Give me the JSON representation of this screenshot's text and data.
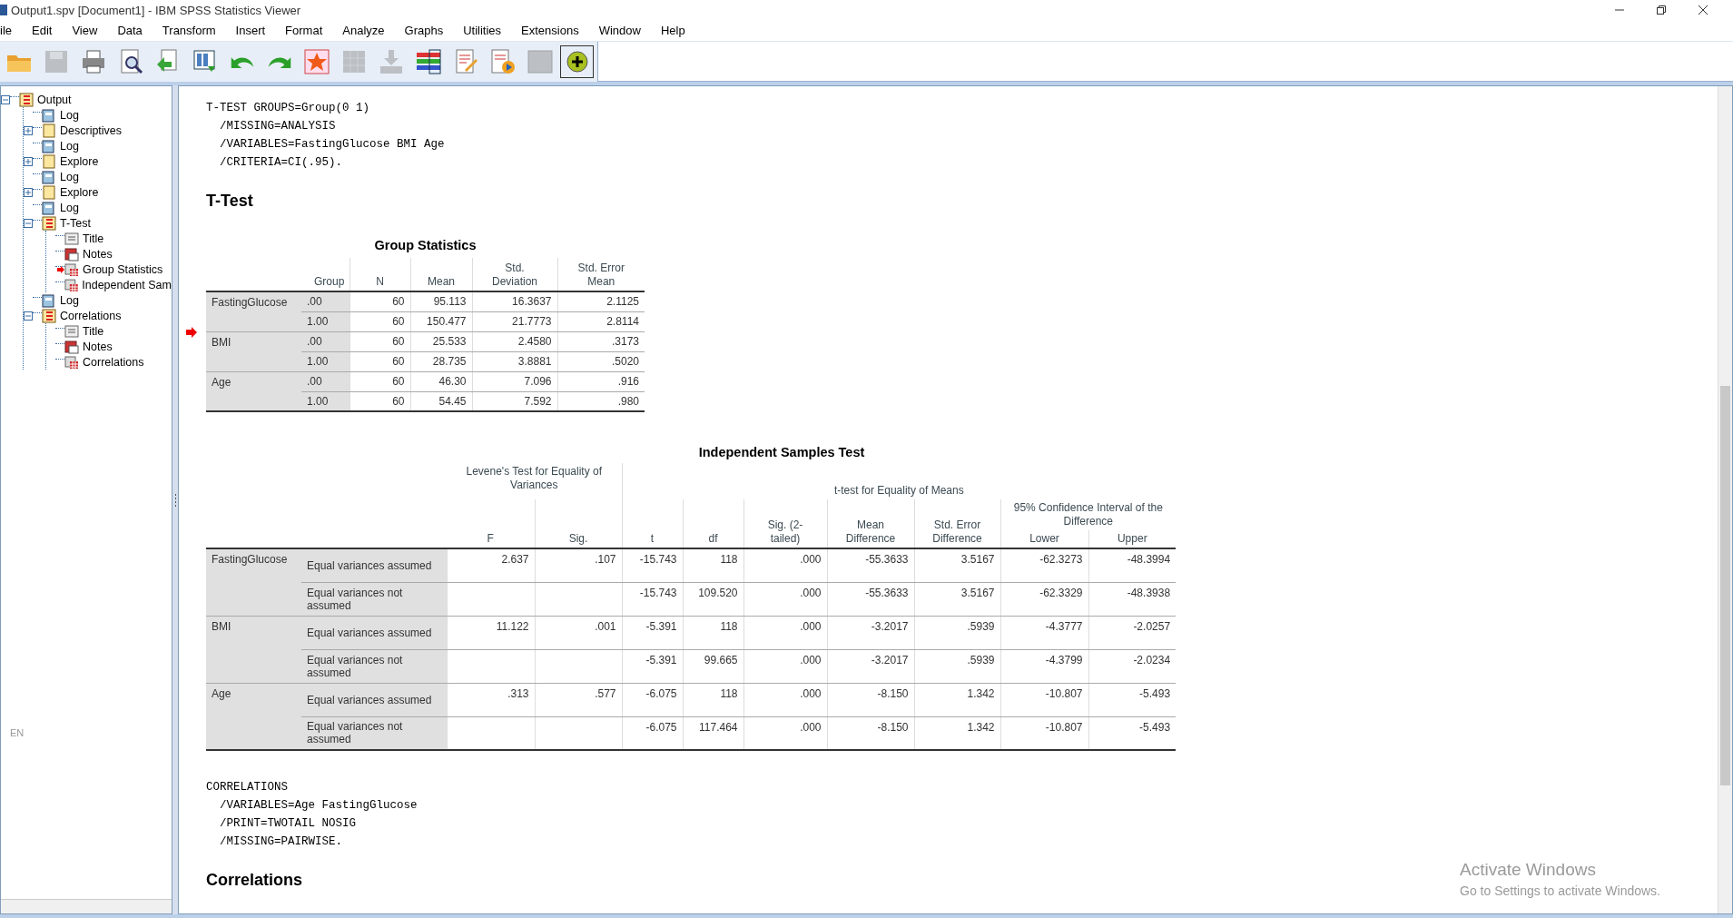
{
  "window": {
    "title": "Output1.spv [Document1] - IBM SPSS Statistics Viewer"
  },
  "menu": [
    "ile",
    "Edit",
    "View",
    "Data",
    "Transform",
    "Insert",
    "Format",
    "Analyze",
    "Graphs",
    "Utilities",
    "Extensions",
    "Window",
    "Help"
  ],
  "toolbar": [
    {
      "kind": "open",
      "disabled": false
    },
    {
      "kind": "save",
      "disabled": true
    },
    {
      "kind": "print",
      "disabled": false
    },
    {
      "kind": "preview",
      "disabled": false
    },
    {
      "kind": "export",
      "disabled": false
    },
    {
      "kind": "goto-data",
      "disabled": false
    },
    {
      "kind": "undo",
      "disabled": false
    },
    {
      "kind": "redo",
      "disabled": false
    },
    {
      "kind": "star",
      "disabled": false
    },
    {
      "kind": "grid",
      "disabled": true
    },
    {
      "kind": "download",
      "disabled": true
    },
    {
      "kind": "variables",
      "disabled": false
    },
    {
      "kind": "edit-doc",
      "disabled": false
    },
    {
      "kind": "run-doc",
      "disabled": false
    },
    {
      "kind": "square",
      "disabled": true
    },
    {
      "kind": "add",
      "disabled": false
    }
  ],
  "outline": [
    {
      "label": "Output",
      "kind": "heading",
      "expanded": true,
      "current": false,
      "children": [
        {
          "label": "Log",
          "kind": "log",
          "current": false
        },
        {
          "label": "Descriptives",
          "kind": "heading",
          "expanded": false,
          "current": false
        },
        {
          "label": "Log",
          "kind": "log",
          "current": false
        },
        {
          "label": "Explore",
          "kind": "heading",
          "expanded": false,
          "current": false
        },
        {
          "label": "Log",
          "kind": "log",
          "current": false
        },
        {
          "label": "Explore",
          "kind": "heading",
          "expanded": false,
          "current": false
        },
        {
          "label": "Log",
          "kind": "log",
          "current": false
        },
        {
          "label": "T-Test",
          "kind": "heading",
          "expanded": true,
          "current": false,
          "children": [
            {
              "label": "Title",
              "kind": "title",
              "current": false
            },
            {
              "label": "Notes",
              "kind": "notes",
              "current": false
            },
            {
              "label": "Group Statistics",
              "kind": "table",
              "current": true
            },
            {
              "label": "Independent Sam",
              "kind": "table",
              "current": false
            }
          ]
        },
        {
          "label": "Log",
          "kind": "log",
          "current": false
        },
        {
          "label": "Correlations",
          "kind": "heading",
          "expanded": true,
          "current": false,
          "children": [
            {
              "label": "Title",
              "kind": "title",
              "current": false
            },
            {
              "label": "Notes",
              "kind": "notes",
              "current": false
            },
            {
              "label": "Correlations",
              "kind": "table",
              "current": false
            }
          ]
        }
      ]
    }
  ],
  "language_indicator": "EN",
  "output": [
    {
      "kind": "syntax",
      "lines": [
        "T-TEST GROUPS=Group(0 1)",
        "  /MISSING=ANALYSIS",
        "  /VARIABLES=FastingGlucose BMI Age",
        "  /CRITERIA=CI(.95)."
      ]
    },
    {
      "kind": "heading",
      "text": "T-Test"
    },
    {
      "kind": "group_stats",
      "title": "Group Statistics",
      "current": true,
      "columns": [
        "Group",
        "N",
        "Mean",
        "Std. Deviation",
        "Std. Error Mean"
      ],
      "variables": [
        {
          "name": "FastingGlucose",
          "rows": [
            {
              "group": ".00",
              "values": [
                "60",
                "95.113",
                "16.3637",
                "2.1125"
              ]
            },
            {
              "group": "1.00",
              "values": [
                "60",
                "150.477",
                "21.7773",
                "2.8114"
              ]
            }
          ]
        },
        {
          "name": "BMI",
          "rows": [
            {
              "group": ".00",
              "values": [
                "60",
                "25.533",
                "2.4580",
                ".3173"
              ]
            },
            {
              "group": "1.00",
              "values": [
                "60",
                "28.735",
                "3.8881",
                ".5020"
              ]
            }
          ]
        },
        {
          "name": "Age",
          "rows": [
            {
              "group": ".00",
              "values": [
                "60",
                "46.30",
                "7.096",
                ".916"
              ]
            },
            {
              "group": "1.00",
              "values": [
                "60",
                "54.45",
                "7.592",
                ".980"
              ]
            }
          ]
        }
      ]
    },
    {
      "kind": "indep_test",
      "title": "Independent Samples Test",
      "levene_header": "Levene's Test for Equality of Variances",
      "ttest_header": "t-test for Equality of Means",
      "columns": [
        "F",
        "Sig.",
        "t",
        "df",
        "Sig. (2-tailed)",
        "Mean Difference",
        "Std. Error Difference"
      ],
      "ci_header": "95% Confidence Interval of the Difference",
      "ci_columns": [
        "Lower",
        "Upper"
      ],
      "variables": [
        {
          "name": "FastingGlucose",
          "rows": [
            {
              "label": "Equal variances assumed",
              "levene": [
                "2.637",
                ".107"
              ],
              "values": [
                "-15.743",
                "118",
                ".000",
                "-55.3633",
                "3.5167",
                "-62.3273",
                "-48.3994"
              ]
            },
            {
              "label": "Equal variances not assumed",
              "values": [
                "-15.743",
                "109.520",
                ".000",
                "-55.3633",
                "3.5167",
                "-62.3329",
                "-48.3938"
              ]
            }
          ]
        },
        {
          "name": "BMI",
          "rows": [
            {
              "label": "Equal variances assumed",
              "levene": [
                "11.122",
                ".001"
              ],
              "values": [
                "-5.391",
                "118",
                ".000",
                "-3.2017",
                ".5939",
                "-4.3777",
                "-2.0257"
              ]
            },
            {
              "label": "Equal variances not assumed",
              "values": [
                "-5.391",
                "99.665",
                ".000",
                "-3.2017",
                ".5939",
                "-4.3799",
                "-2.0234"
              ]
            }
          ]
        },
        {
          "name": "Age",
          "rows": [
            {
              "label": "Equal variances assumed",
              "levene": [
                ".313",
                ".577"
              ],
              "values": [
                "-6.075",
                "118",
                ".000",
                "-8.150",
                "1.342",
                "-10.807",
                "-5.493"
              ]
            },
            {
              "label": "Equal variances not assumed",
              "values": [
                "-6.075",
                "117.464",
                ".000",
                "-8.150",
                "1.342",
                "-10.807",
                "-5.493"
              ]
            }
          ]
        }
      ]
    },
    {
      "kind": "syntax",
      "lines": [
        "CORRELATIONS",
        "  /VARIABLES=Age FastingGlucose",
        "  /PRINT=TWOTAIL NOSIG",
        "  /MISSING=PAIRWISE."
      ]
    },
    {
      "kind": "heading",
      "text": "Correlations"
    }
  ],
  "activation": {
    "title": "Activate Windows",
    "text": "Go to Settings to activate Windows."
  }
}
